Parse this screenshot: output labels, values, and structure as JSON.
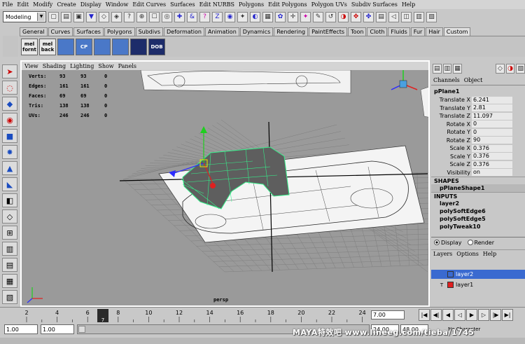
{
  "menubar": [
    "File",
    "Edit",
    "Modify",
    "Create",
    "Display",
    "Window",
    "Edit Curves",
    "Surfaces",
    "Edit NURBS",
    "Polygons",
    "Edit Polygons",
    "Polygon UVs",
    "Subdiv Surfaces",
    "Help"
  ],
  "status": {
    "mode": "Modeling"
  },
  "shelf_tabs": [
    "General",
    "Curves",
    "Surfaces",
    "Polygons",
    "Subdivs",
    "Deformation",
    "Animation",
    "Dynamics",
    "Rendering",
    "PaintEffects",
    "Toon",
    "Cloth",
    "Fluids",
    "Fur",
    "Hair",
    "Custom"
  ],
  "shelf_buttons": [
    {
      "top": "mel",
      "bottom": "fornt"
    },
    {
      "top": "mel",
      "bottom": "back"
    },
    {
      "top": "",
      "bottom": ""
    },
    {
      "top": "",
      "bottom": "CP"
    },
    {
      "top": "",
      "bottom": ""
    },
    {
      "top": "",
      "bottom": ""
    },
    {
      "top": "",
      "bottom": ""
    },
    {
      "top": "",
      "bottom": "DOB"
    }
  ],
  "viewport": {
    "menu": [
      "View",
      "Shading",
      "Lighting",
      "Show",
      "Panels"
    ],
    "hud": [
      {
        "label": "Verts:",
        "v1": "93",
        "v2": "93",
        "v3": "0"
      },
      {
        "label": "Edges:",
        "v1": "161",
        "v2": "161",
        "v3": "0"
      },
      {
        "label": "Faces:",
        "v1": "69",
        "v2": "69",
        "v3": "0"
      },
      {
        "label": "Tris:",
        "v1": "138",
        "v2": "138",
        "v3": "0"
      },
      {
        "label": "UVs:",
        "v1": "246",
        "v2": "246",
        "v3": "0"
      }
    ],
    "camera": "persp",
    "axis_labels": {
      "x": "x",
      "y": "y",
      "z": "z"
    }
  },
  "channel_box": {
    "menu": [
      "Channels",
      "Object"
    ],
    "object": "pPlane1",
    "attributes": [
      {
        "name": "Translate X",
        "value": "6.241"
      },
      {
        "name": "Translate Y",
        "value": "2.81"
      },
      {
        "name": "Translate Z",
        "value": "11.097"
      },
      {
        "name": "Rotate X",
        "value": "0"
      },
      {
        "name": "Rotate Y",
        "value": "0"
      },
      {
        "name": "Rotate Z",
        "value": "90"
      },
      {
        "name": "Scale X",
        "value": "0.376"
      },
      {
        "name": "Scale Y",
        "value": "0.376"
      },
      {
        "name": "Scale Z",
        "value": "0.376"
      },
      {
        "name": "Visibility",
        "value": "on"
      }
    ],
    "shapes_header": "SHAPES",
    "shapes": [
      "pPlaneShape1"
    ],
    "inputs_header": "INPUTS",
    "inputs": [
      "layer2",
      "polySoftEdge6",
      "polySoftEdge5",
      "polyTweak10"
    ]
  },
  "layers": {
    "display_label": "Display",
    "render_label": "Render",
    "menu": [
      "Layers",
      "Options",
      "Help"
    ],
    "items": [
      {
        "name": "layer2",
        "color": "#3a6ad0",
        "selected": true
      },
      {
        "name": "layer1",
        "color": "#e02020",
        "selected": false,
        "flag": "T"
      }
    ]
  },
  "timeline": {
    "ticks": [
      "2",
      "4",
      "6",
      "8",
      "10",
      "12",
      "14",
      "16",
      "18",
      "20",
      "22",
      "24"
    ],
    "current_frame": "7",
    "current_frame_field": "7.00"
  },
  "range": {
    "start": "1.00",
    "start2": "1.00",
    "end": "24.00",
    "end2": "48.00",
    "character_label": "No Character"
  },
  "watermark": "MAYA特效吧  www.lineeg.com/tieba/1745"
}
